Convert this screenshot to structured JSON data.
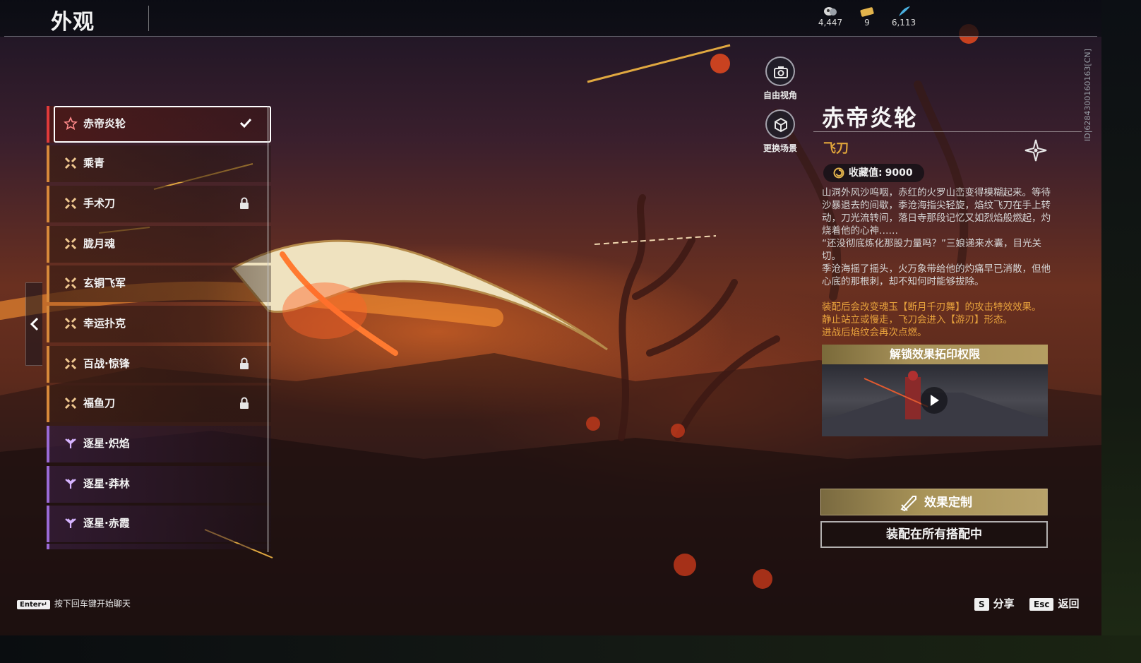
{
  "header": {
    "title": "外观",
    "currencies": [
      {
        "icon": "spirit-orb-icon",
        "value": "4,447"
      },
      {
        "icon": "ticket-icon",
        "value": "9"
      },
      {
        "icon": "feather-icon",
        "value": "6,113"
      }
    ]
  },
  "list": {
    "items": [
      {
        "label": "赤帝炎轮",
        "rarity": "red",
        "state": "selected"
      },
      {
        "label": "乘青",
        "rarity": "gold",
        "state": "owned"
      },
      {
        "label": "手术刀",
        "rarity": "gold",
        "state": "locked"
      },
      {
        "label": "胧月魂",
        "rarity": "gold",
        "state": "owned"
      },
      {
        "label": "玄铜飞军",
        "rarity": "gold",
        "state": "owned"
      },
      {
        "label": "幸运扑克",
        "rarity": "gold",
        "state": "owned"
      },
      {
        "label": "百战·惊锋",
        "rarity": "gold",
        "state": "locked"
      },
      {
        "label": "福鱼刀",
        "rarity": "gold",
        "state": "locked"
      },
      {
        "label": "逐星·炽焰",
        "rarity": "purple",
        "state": "owned"
      },
      {
        "label": "逐星·莽林",
        "rarity": "purple",
        "state": "owned"
      },
      {
        "label": "逐星·赤霞",
        "rarity": "purple",
        "state": "owned"
      }
    ]
  },
  "view_buttons": {
    "free_view": "自由视角",
    "change_scene": "更换场景"
  },
  "detail": {
    "title": "赤帝炎轮",
    "category": "飞刀",
    "collect_label": "收藏值:",
    "collect_value": "9000",
    "description": [
      "山洞外风沙呜咽，赤红的火罗山峦变得模糊起来。等待沙暴退去的间歇，季沧海指尖轻旋，焰纹飞刀在手上转动，刀光流转间，落日寺那段记忆又如烈焰般燃起，灼烧着他的心神……",
      "“还没彻底炼化那股力量吗？”三娘递来水囊，目光关切。",
      "季沧海摇了摇头，火万象带给他的灼痛早已消散，但他心底的那根刺，却不知何时能够拔除。"
    ],
    "effect": [
      "装配后会改变魂玉【断月千刃舞】的攻击特效效果。",
      "静止站立或慢走，飞刀会进入【游刃】形态。",
      "进战后焰纹会再次点燃。"
    ],
    "unlock_title": "解锁效果拓印权限",
    "customize_label": "效果定制",
    "equip_label": "装配在所有搭配中",
    "side_id": "ID|6284300160163[CN]"
  },
  "footer": {
    "enter_key": "Enter↵",
    "enter_hint": "按下回车键开始聊天",
    "share_key": "S",
    "share_label": "分享",
    "back_key": "Esc",
    "back_label": "返回"
  },
  "colors": {
    "accent_gold": "#e0a53a",
    "rarity_red": "#e03a3a",
    "rarity_gold": "#d8893a",
    "rarity_purple": "#9a6ad6"
  }
}
